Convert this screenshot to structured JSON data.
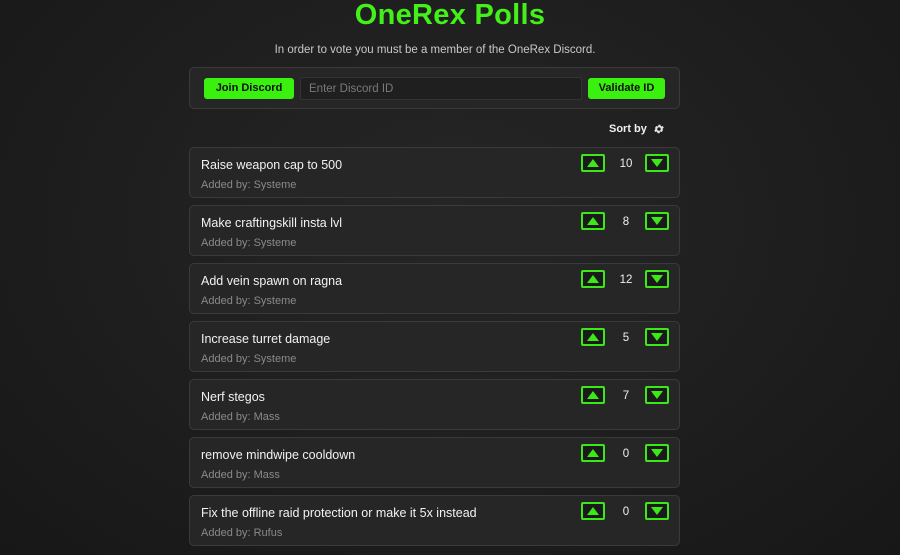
{
  "header": {
    "title": "OneRex Polls",
    "notice": "In order to vote you must be a member of the OneRex Discord."
  },
  "discord_panel": {
    "join_label": "Join Discord",
    "input_placeholder": "Enter Discord ID",
    "input_value": "",
    "validate_label": "Validate ID"
  },
  "sort": {
    "label": "Sort by",
    "icon": "gear-icon"
  },
  "colors": {
    "accent": "#39f00e",
    "background": "#1e1e1e",
    "card": "#262626"
  },
  "polls": [
    {
      "title": "Raise weapon cap to 500",
      "author": "Added by: Systeme",
      "votes": "10"
    },
    {
      "title": "Make craftingskill insta lvl",
      "author": "Added by: Systeme",
      "votes": "8"
    },
    {
      "title": "Add vein spawn on ragna",
      "author": "Added by: Systeme",
      "votes": "12"
    },
    {
      "title": "Increase turret damage",
      "author": "Added by: Systeme",
      "votes": "5"
    },
    {
      "title": "Nerf stegos",
      "author": "Added by: Mass",
      "votes": "7"
    },
    {
      "title": "remove mindwipe cooldown",
      "author": "Added by: Mass",
      "votes": "0"
    },
    {
      "title": "Fix the offline raid protection or make it 5x instead",
      "author": "Added by: Rufus",
      "votes": "0"
    }
  ]
}
